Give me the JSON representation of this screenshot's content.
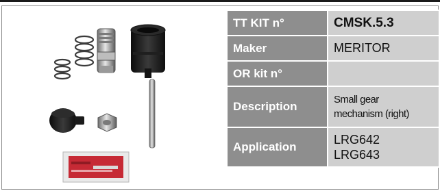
{
  "spec_table": {
    "rows": [
      {
        "label": "TT KIT n°",
        "value": "CMSK.5.3"
      },
      {
        "label": "Maker",
        "value": "MERITOR"
      },
      {
        "label": "OR kit n°",
        "value": ""
      },
      {
        "label": "Description",
        "value_lines": [
          "Small gear",
          "mechanism (right)"
        ]
      },
      {
        "label": "Application",
        "value_lines": [
          "LRG642",
          "LRG643"
        ]
      }
    ]
  },
  "colors": {
    "label_bg": "#8e8e8e",
    "value_bg": "#cfcfcf",
    "label_text": "#ffffff",
    "frame_border": "#8a8a8a"
  },
  "photo": {
    "icon_names": [
      "spring-icon",
      "shaft-icon",
      "gear-housing-icon",
      "spring-icon",
      "pin-icon",
      "cap-icon",
      "nut-icon",
      "grease-sachet-icon"
    ]
  }
}
